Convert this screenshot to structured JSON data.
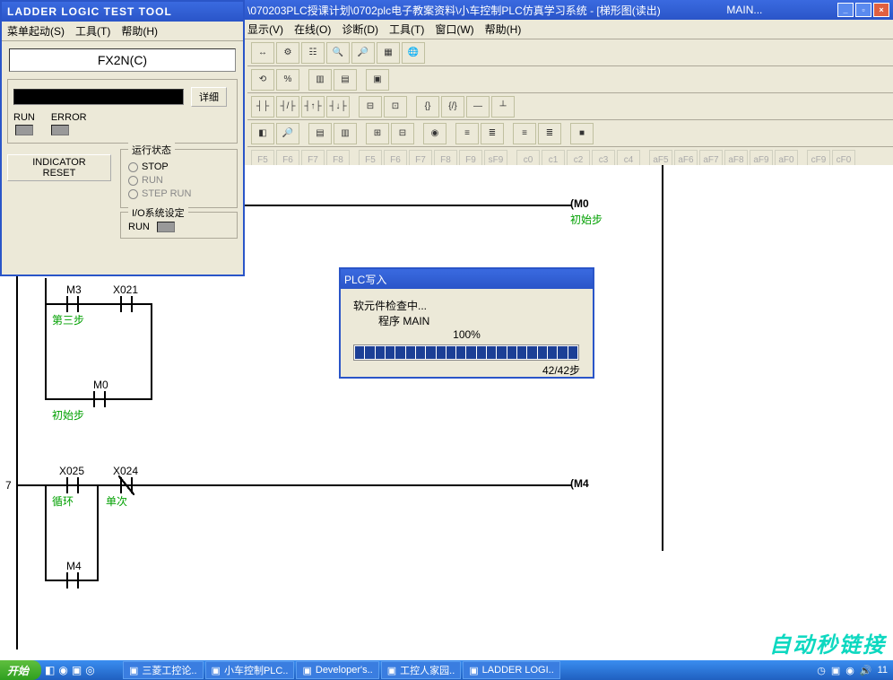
{
  "main_window": {
    "title_path": "\\070203PLC授课计划\\0702plc电子教案资料\\小车控制PLC仿真学习系统 - [梯形图(读出)",
    "title_suffix": "MAIN..."
  },
  "menubar": [
    "显示(V)",
    "在线(O)",
    "诊断(D)",
    "工具(T)",
    "窗口(W)",
    "帮助(H)"
  ],
  "toolbar_rows": [
    [
      "↔",
      "⚙",
      "☷",
      "🔍",
      "🔎",
      "▦",
      "🌐"
    ],
    [
      "⟲",
      "%",
      "│",
      "▥",
      "▤",
      "│",
      "▣"
    ],
    [
      "┤├",
      "┤/├",
      "┤↑├",
      "┤↓├",
      "│",
      "⊟",
      "⊡",
      "│",
      "{}",
      "{/}",
      "—",
      "┴"
    ],
    [
      "◧",
      "🔎",
      "│",
      "▤",
      "▥",
      "│",
      "⊞",
      "⊟",
      "│",
      "◉",
      "│",
      "≡",
      "≣",
      "│",
      "≡",
      "≣",
      "│",
      "■"
    ],
    [
      "F5",
      "F6",
      "F7",
      "F8",
      "│",
      "F5",
      "F6",
      "F7",
      "F8",
      "F9",
      "sF9",
      "│",
      "c0",
      "c1",
      "c2",
      "c3",
      "c4",
      "│",
      "aF5",
      "aF6",
      "aF7",
      "aF8",
      "aF9",
      "aF0",
      "│",
      "cF9",
      "cF0"
    ]
  ],
  "ladder": {
    "rung7": "7",
    "m3": "M3",
    "x021": "X021",
    "m0_left": "M0",
    "step3": "第三步",
    "initstep_left": "初始步",
    "x025": "X025",
    "x024": "X024",
    "loop": "循环",
    "single": "单次",
    "m4_left": "M4",
    "coil_m0": "(M0",
    "coil_m0_label": "初始步",
    "coil_m4": "(M4"
  },
  "ladder_tool": {
    "title": "LADDER LOGIC TEST TOOL",
    "menu": [
      "菜单起动(S)",
      "工具(T)",
      "帮助(H)"
    ],
    "plc_type": "FX2N(C)",
    "detail_btn": "详细",
    "run_label": "RUN",
    "error_label": "ERROR",
    "indicator_reset": "INDICATOR RESET",
    "run_status_title": "运行状态",
    "stop": "STOP",
    "run": "RUN",
    "steprun": "STEP RUN",
    "io_title": "I/O系统设定",
    "io_run": "RUN"
  },
  "plc_dialog": {
    "title": "PLC写入",
    "line1": "软元件检查中...",
    "line2": "程序   MAIN",
    "percent": "100%",
    "steps": "42/42步"
  },
  "taskbar": {
    "start": "开始",
    "tasks": [
      "三菱工控论..",
      "小车控制PLC..",
      "Developer's..",
      "工控人家园..",
      "LADDER LOGI.."
    ],
    "time": "11"
  },
  "watermark": "自动秒链接"
}
